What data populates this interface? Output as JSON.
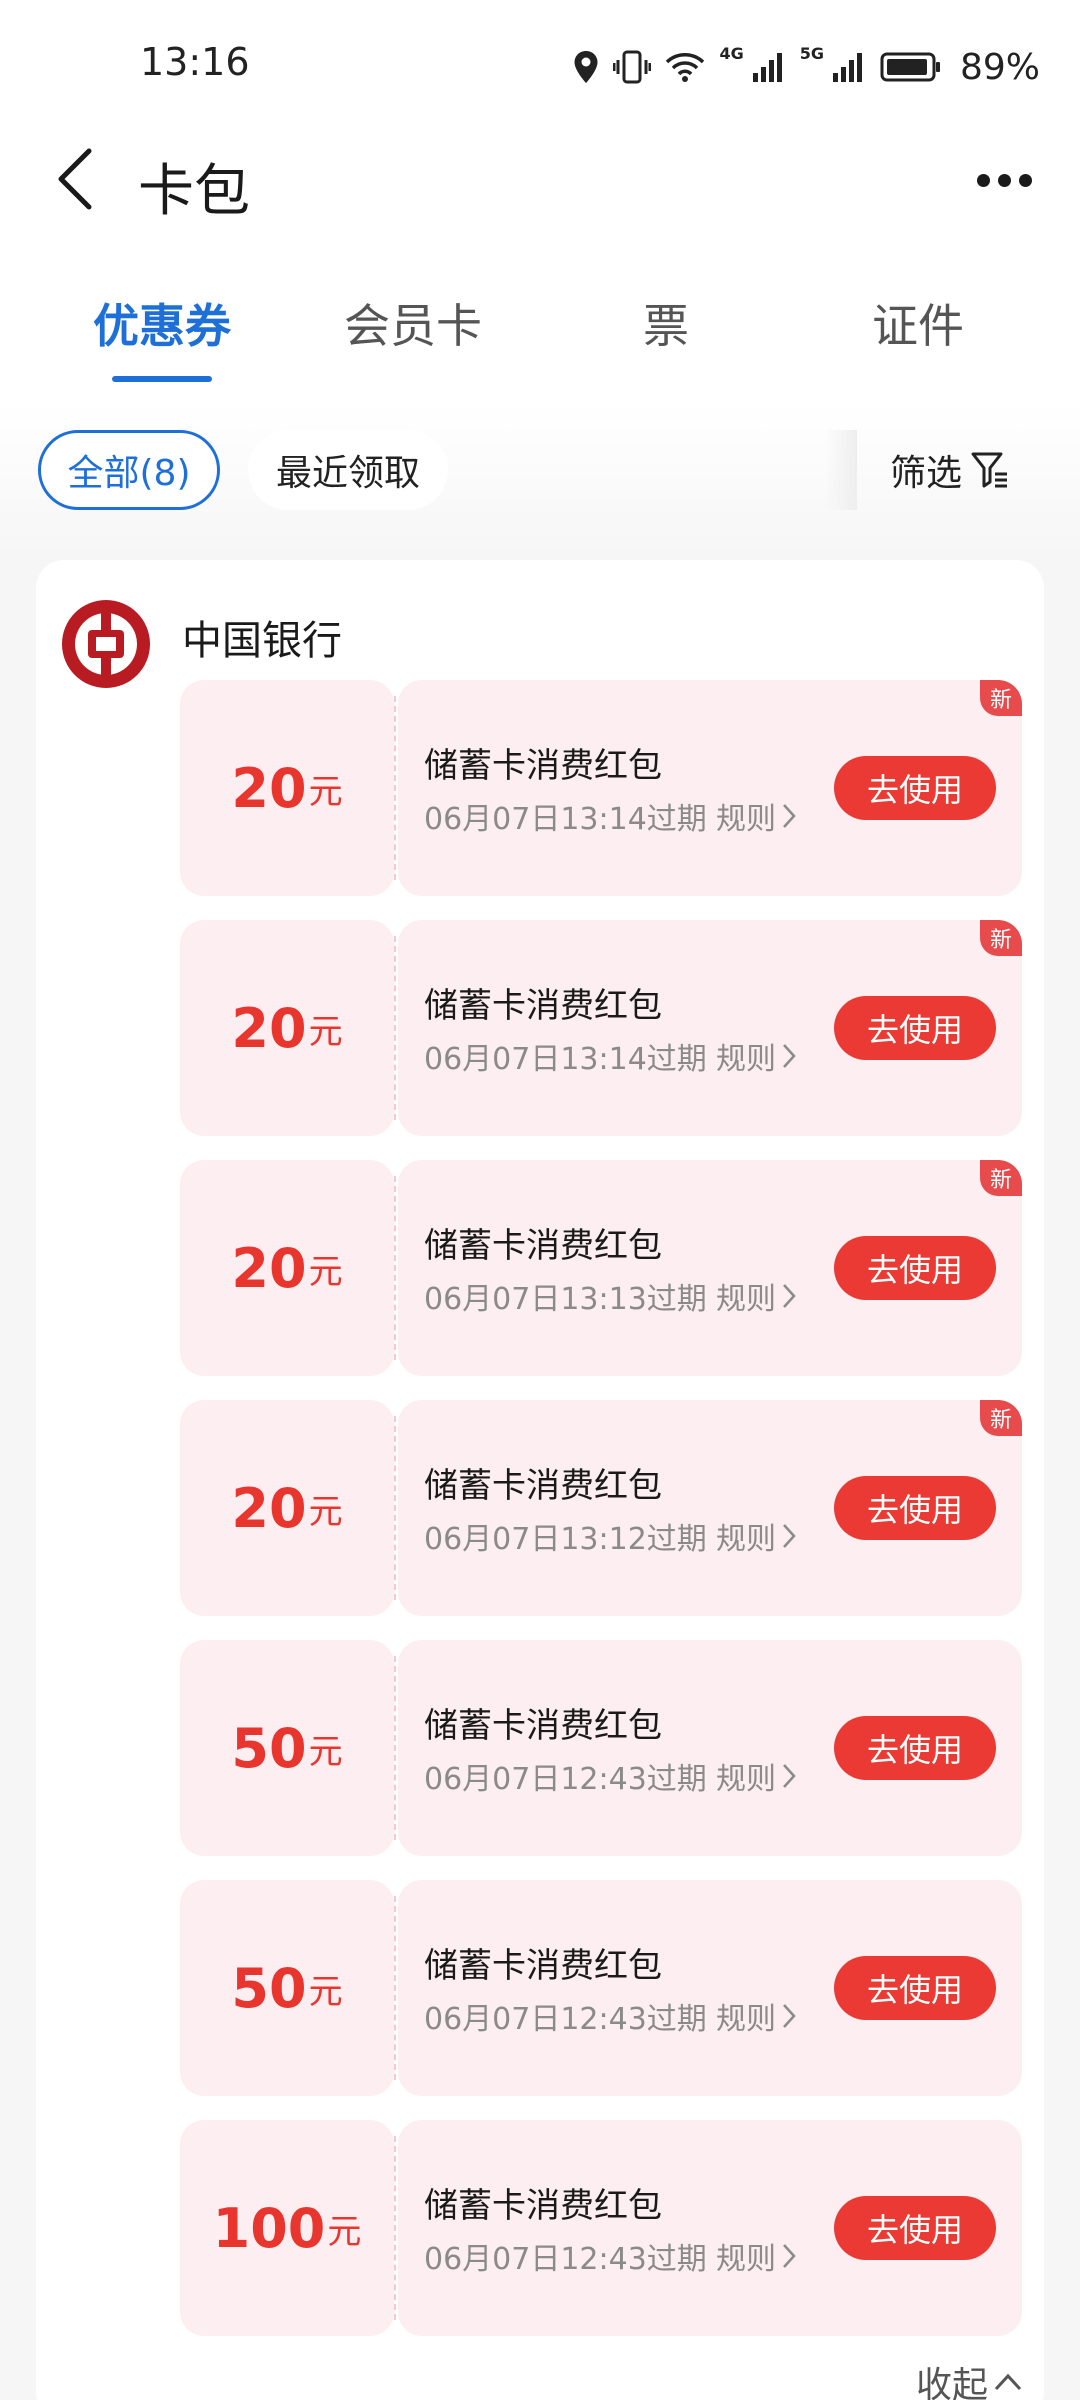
{
  "status_bar": {
    "time": "13:16",
    "network_1": "4G",
    "network_2": "5G",
    "battery_percent": "89%"
  },
  "header": {
    "title": "卡包"
  },
  "tabs": [
    {
      "label": "优惠券",
      "active": true
    },
    {
      "label": "会员卡",
      "active": false
    },
    {
      "label": "票",
      "active": false
    },
    {
      "label": "证件",
      "active": false
    }
  ],
  "filters": {
    "all": "全部(8)",
    "recent": "最近领取",
    "filter": "筛选"
  },
  "bank": {
    "name": "中国银行",
    "brand_color": "#b81c22"
  },
  "coupons": [
    {
      "amount": "20",
      "unit": "元",
      "title": "储蓄卡消费红包",
      "expiry": "06月07日13:14过期",
      "rule": "规则",
      "action": "去使用",
      "badge": "新"
    },
    {
      "amount": "20",
      "unit": "元",
      "title": "储蓄卡消费红包",
      "expiry": "06月07日13:14过期",
      "rule": "规则",
      "action": "去使用",
      "badge": "新"
    },
    {
      "amount": "20",
      "unit": "元",
      "title": "储蓄卡消费红包",
      "expiry": "06月07日13:13过期",
      "rule": "规则",
      "action": "去使用",
      "badge": "新"
    },
    {
      "amount": "20",
      "unit": "元",
      "title": "储蓄卡消费红包",
      "expiry": "06月07日13:12过期",
      "rule": "规则",
      "action": "去使用",
      "badge": "新"
    },
    {
      "amount": "50",
      "unit": "元",
      "title": "储蓄卡消费红包",
      "expiry": "06月07日12:43过期",
      "rule": "规则",
      "action": "去使用"
    },
    {
      "amount": "50",
      "unit": "元",
      "title": "储蓄卡消费红包",
      "expiry": "06月07日12:43过期",
      "rule": "规则",
      "action": "去使用"
    },
    {
      "amount": "100",
      "unit": "元",
      "title": "储蓄卡消费红包",
      "expiry": "06月07日12:43过期",
      "rule": "规则",
      "action": "去使用"
    }
  ],
  "footer": {
    "collapse": "收起"
  },
  "colors": {
    "accent": "#1e6fd8",
    "coupon_red": "#ea3a33",
    "coupon_bg": "#fdeff1"
  }
}
